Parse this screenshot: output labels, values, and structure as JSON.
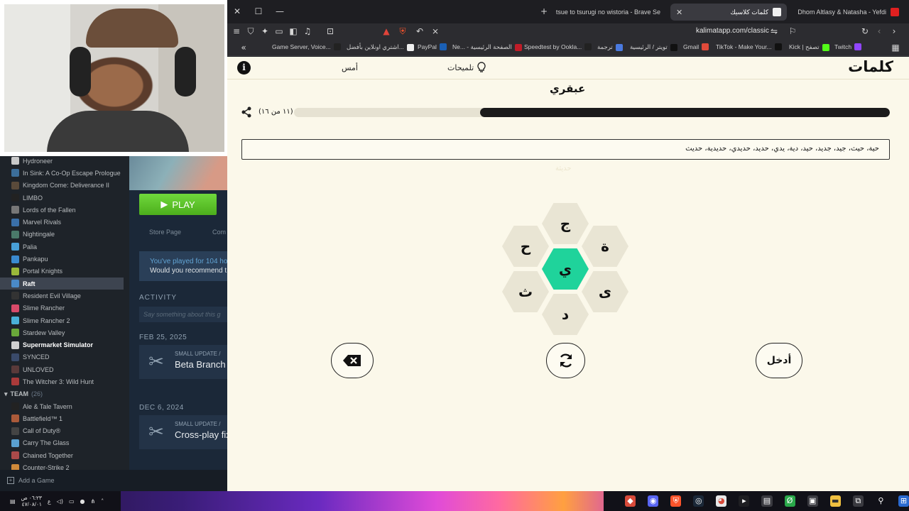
{
  "steam": {
    "games": [
      {
        "name": "Hydroneer",
        "color": "#c9c9c9"
      },
      {
        "name": "In Sink: A Co-Op Escape Prologue",
        "color": "#3c6e9a"
      },
      {
        "name": "Kingdom Come: Deliverance II",
        "color": "#5a4a3a"
      },
      {
        "name": "LIMBO",
        "color": "#222"
      },
      {
        "name": "Lords of the Fallen",
        "color": "#777"
      },
      {
        "name": "Marvel Rivals",
        "color": "#3a6fa8"
      },
      {
        "name": "Nightingale",
        "color": "#4a7a6a"
      },
      {
        "name": "Palia",
        "color": "#48a0d8"
      },
      {
        "name": "Pankapu",
        "color": "#3a8ad0"
      },
      {
        "name": "Portal Knights",
        "color": "#9ab83a"
      },
      {
        "name": "Raft",
        "color": "#4a8ac8"
      },
      {
        "name": "Resident Evil Village",
        "color": "#333"
      },
      {
        "name": "Slime Rancher",
        "color": "#d84a6a"
      },
      {
        "name": "Slime Rancher 2",
        "color": "#4ab0d8"
      },
      {
        "name": "Stardew Valley",
        "color": "#6aa83a"
      },
      {
        "name": "Supermarket Simulator",
        "color": "#d0d0d0"
      },
      {
        "name": "SYNCED",
        "color": "#3a4a6a"
      },
      {
        "name": "UNLOVED",
        "color": "#5a3a3a"
      },
      {
        "name": "The Witcher 3: Wild Hunt",
        "color": "#aa3a3a"
      }
    ],
    "team_label": "TEAM",
    "team_count": "(26)",
    "team_games": [
      {
        "name": "Ale & Tale Tavern",
        "color": "#222"
      },
      {
        "name": "Battlefield™ 1",
        "color": "#aa5a3a"
      },
      {
        "name": "Call of Duty®",
        "color": "#444"
      },
      {
        "name": "Carry The Glass",
        "color": "#5aa0d0"
      },
      {
        "name": "Chained Together",
        "color": "#aa4a4a"
      },
      {
        "name": "Counter-Strike 2",
        "color": "#d08a3a"
      }
    ],
    "add_game": "Add a Game",
    "play_label": "PLAY",
    "tab_store": "Store Page",
    "tab_community": "Com",
    "played_line1": "You've played for 104 ho",
    "played_line2": "Would you recommend t",
    "activity_label": "ACTIVITY",
    "say_placeholder": "Say something about this g",
    "date1": "FEB 25, 2025",
    "update1_type": "SMALL UPDATE /",
    "update1_title": "Beta Branch",
    "date2": "DEC 6, 2024",
    "update2_type": "SMALL UPDATE /",
    "update2_title": "Cross-play fix"
  },
  "browser": {
    "tabs": [
      {
        "title": "tsue to tsurugi no wistoria - Brave Se",
        "active": false,
        "color": "#e04a4a"
      },
      {
        "title": "كلمات كلاسيك",
        "active": true,
        "color": "#f0f0f0"
      },
      {
        "title": "Dhom Altlasy & Natasha - Yefdi",
        "color": "#e02020",
        "active": false
      }
    ],
    "url": "kalimatapp.com/classic",
    "bookmarks": [
      {
        "label": "Game Server, Voice...",
        "color": "#222"
      },
      {
        "label": "اشتري اونلاين بأفضل...",
        "color": "#f0f0f0"
      },
      {
        "label": "PayPal",
        "color": "#1a5fb4"
      },
      {
        "label": "Ne... - الصفحة الرئيسية",
        "color": "#c01c28"
      },
      {
        "label": "Speedtest by Ookla...",
        "color": "#222"
      },
      {
        "label": "ترجمة",
        "color": "#4a7ae0"
      },
      {
        "label": "تويتر / الرئيسية",
        "color": "#111"
      },
      {
        "label": "Gmail",
        "color": "#e04a3a"
      },
      {
        "label": "TikTok - Make Your...",
        "color": "#111"
      },
      {
        "label": "Kick | تصفح",
        "color": "#53fc18"
      },
      {
        "label": "Twitch",
        "color": "#9146ff"
      }
    ]
  },
  "game": {
    "logo": "كلمات",
    "hints_label": "تلميحات",
    "yesterday_label": "أمس",
    "rank": "عبقري",
    "progress_text": "(١١ من ١٦)",
    "progress_found": 11,
    "progress_total": 16,
    "found_words": "حية، حيث، جيد، جديد، حيد، دية، يدي، حديد، حديدي، حديدية، حديث",
    "ghost_word": "حديثة",
    "letters": {
      "center": "ي",
      "top": "ج",
      "top_right": "ة",
      "bottom_right": "ى",
      "bottom": "د",
      "bottom_left": "ث",
      "top_left": "ح"
    },
    "enter_label": "أدخل"
  },
  "taskbar": {
    "time": "٠٦:٢٣ ص",
    "date": "٤٧/٠٨/٠١"
  }
}
